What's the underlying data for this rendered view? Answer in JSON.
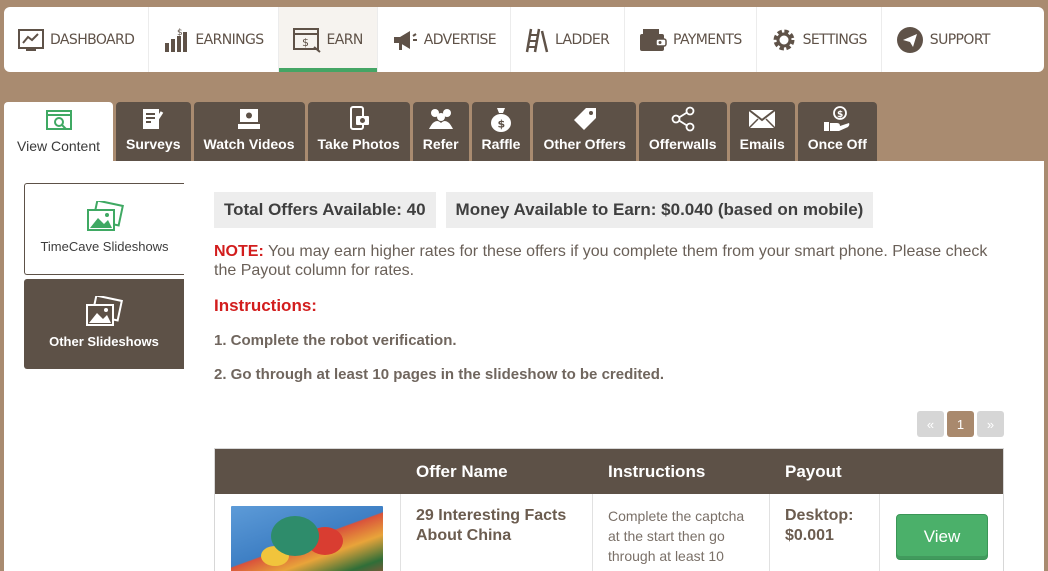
{
  "topnav": {
    "items": [
      {
        "label": "DASHBOARD",
        "icon": "dashboard-icon"
      },
      {
        "label": "EARNINGS",
        "icon": "earnings-chart-icon"
      },
      {
        "label": "EARN",
        "icon": "earn-screen-icon",
        "active": true
      },
      {
        "label": "ADVERTISE",
        "icon": "megaphone-icon"
      },
      {
        "label": "LADDER",
        "icon": "ladder-icon"
      },
      {
        "label": "PAYMENTS",
        "icon": "wallet-icon"
      },
      {
        "label": "SETTINGS",
        "icon": "gear-icon"
      },
      {
        "label": "SUPPORT",
        "icon": "paper-plane-icon"
      }
    ]
  },
  "tabs": [
    {
      "label": "View Content",
      "icon": "view-content-icon",
      "active": true
    },
    {
      "label": "Surveys",
      "icon": "survey-icon"
    },
    {
      "label": "Watch Videos",
      "icon": "video-icon"
    },
    {
      "label": "Take Photos",
      "icon": "photo-icon"
    },
    {
      "label": "Refer",
      "icon": "people-icon"
    },
    {
      "label": "Raffle",
      "icon": "money-bag-icon"
    },
    {
      "label": "Other Offers",
      "icon": "tag-icon"
    },
    {
      "label": "Offerwalls",
      "icon": "share-icon"
    },
    {
      "label": "Emails",
      "icon": "envelope-icon"
    },
    {
      "label": "Once Off",
      "icon": "hand-coin-icon"
    }
  ],
  "sidebar": {
    "items": [
      {
        "label": "TimeCave Slideshows",
        "icon": "slideshow-icon",
        "active": true
      },
      {
        "label": "Other Slideshows",
        "icon": "slideshow-icon"
      }
    ]
  },
  "content": {
    "total_offers": "Total Offers Available: 40",
    "money_available": "Money Available to Earn: $0.040 (based on mobile)",
    "note_label": "NOTE:",
    "note_text": " You may earn higher rates for these offers if you complete them from your smart phone. Please check the Payout column for rates.",
    "instructions_label": "Instructions:",
    "steps": [
      "1. Complete the robot verification.",
      "2. Go through at least 10 pages in the slideshow to be credited."
    ]
  },
  "pager": {
    "prev": "«",
    "current": "1",
    "next": "»"
  },
  "table": {
    "headers": [
      "",
      "Offer Name",
      "Instructions",
      "Payout",
      ""
    ],
    "rows": [
      {
        "offer_name": "29 Interesting Facts About China",
        "instructions": "Complete the captcha at the start then go through at least 10",
        "payout_label": "Desktop:",
        "payout_value": "$0.001",
        "button": "View"
      }
    ]
  },
  "colors": {
    "background": "#a98b70",
    "dark_brown": "#5d5147",
    "accent_green": "#4bb06a",
    "note_red": "#d21d1d"
  }
}
